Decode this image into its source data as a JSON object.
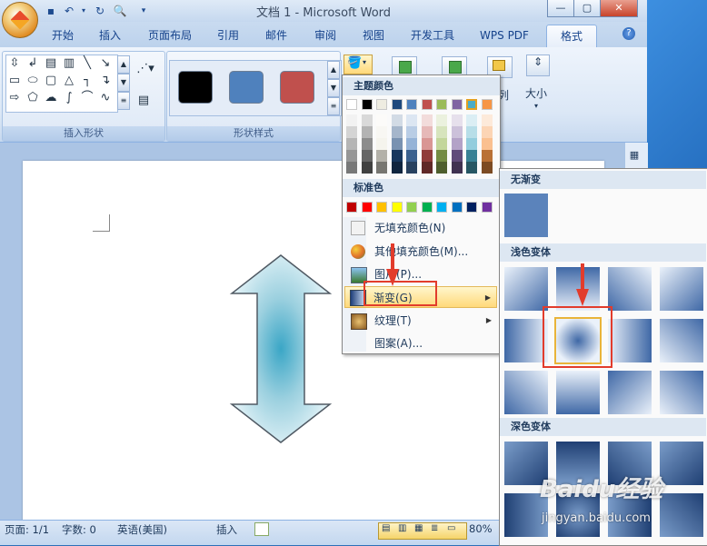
{
  "window": {
    "title": "文档 1 - Microsoft Word"
  },
  "tabs": [
    "开始",
    "插入",
    "页面布局",
    "引用",
    "邮件",
    "审阅",
    "视图",
    "开发工具",
    "WPS PDF",
    "格式"
  ],
  "active_tab": "格式",
  "ribbon": {
    "groups": {
      "insert_shapes": "插入形状",
      "shape_styles": "形状样式"
    },
    "size_label": "大小",
    "arrange_partial": "列",
    "style_swatch_colors": [
      "#000000",
      "#4f81bd",
      "#c0504d"
    ]
  },
  "color_menu": {
    "theme_colors_header": "主题颜色",
    "standard_colors_header": "标准色",
    "theme_top_row": [
      "#ffffff",
      "#000000",
      "#eeece1",
      "#1f497d",
      "#4f81bd",
      "#c0504d",
      "#9bbb59",
      "#8064a2",
      "#4bacc6",
      "#f79646"
    ],
    "standard_row": [
      "#c00000",
      "#ff0000",
      "#ffc000",
      "#ffff00",
      "#92d050",
      "#00b050",
      "#00b0f0",
      "#0070c0",
      "#002060",
      "#7030a0"
    ],
    "items": [
      {
        "label": "无填充颜色(N)"
      },
      {
        "label": "其他填充颜色(M)..."
      },
      {
        "label": "图片(P)..."
      },
      {
        "label": "渐变(G)"
      },
      {
        "label": "纹理(T)"
      },
      {
        "label": "图案(A)..."
      }
    ]
  },
  "gradient_menu": {
    "none_header": "无渐变",
    "light_header": "浅色变体",
    "dark_header": "深色变体"
  },
  "status_bar": {
    "page": "页面: 1/1",
    "words": "字数: 0",
    "language": "英语(美国)",
    "insert_mode": "插入",
    "zoom": "80%"
  },
  "watermark": {
    "text": "Baidu经验",
    "url": "jingyan.baidu.com"
  }
}
